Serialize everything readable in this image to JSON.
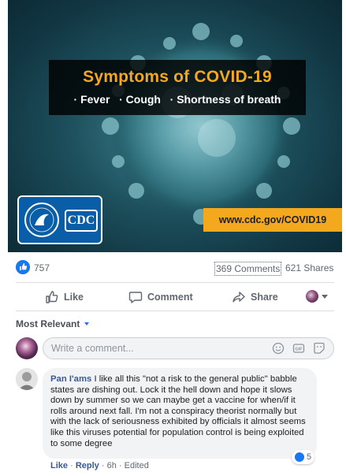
{
  "image": {
    "banner_title": "Symptoms of COVID-19",
    "banner_subtitle": "· Fever   · Cough   · Shortness of breath",
    "logo_text": "CDC",
    "url": "www.cdc.gov/COVID19"
  },
  "stats": {
    "likes": "757",
    "comments": "369 Comments",
    "shares": "621 Shares"
  },
  "actions": {
    "like": "Like",
    "comment": "Comment",
    "share": "Share"
  },
  "sort": {
    "label": "Most Relevant"
  },
  "composer": {
    "placeholder": "Write a comment..."
  },
  "comment": {
    "author": "Pan I'ams",
    "text": "I like all this \"not a risk to the general public\" babble states are dishing out. Lock it the hell down and hope it slows down by summer so we can maybe get a vaccine for when/if it rolls around next fall. I'm not a conspiracy theorist normally but with the lack of seriousness exhibited by officials it almost seems like this viruses potential for population control is being exploited to some degree",
    "reactions": "5",
    "like_label": "Like",
    "reply_label": "Reply",
    "time": "6h",
    "edited": "Edited"
  },
  "colors": {
    "accent": "#1877f2",
    "banner_title": "#f4a81d",
    "url_strip": "#f4a81d",
    "cdc_blue": "#0a5ea8",
    "author": "#385898"
  }
}
